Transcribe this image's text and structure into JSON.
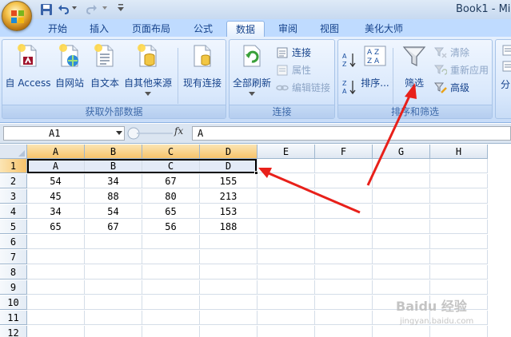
{
  "window": {
    "title": "Book1 - Mi"
  },
  "quick_access": {
    "save_icon": "save-icon",
    "undo_icon": "undo-icon",
    "redo_icon": "redo-icon"
  },
  "tabs": [
    {
      "label": "开始",
      "active": false
    },
    {
      "label": "插入",
      "active": false
    },
    {
      "label": "页面布局",
      "active": false
    },
    {
      "label": "公式",
      "active": false
    },
    {
      "label": "数据",
      "active": true
    },
    {
      "label": "审阅",
      "active": false
    },
    {
      "label": "视图",
      "active": false
    },
    {
      "label": "美化大师",
      "active": false
    }
  ],
  "ribbon": {
    "get_external": {
      "label": "获取外部数据",
      "buttons": [
        "自 Access",
        "自网站",
        "自文本",
        "自其他来源",
        "现有连接"
      ]
    },
    "connections": {
      "label": "连接",
      "refresh_all": "全部刷新",
      "small": [
        "连接",
        "属性",
        "编辑链接"
      ]
    },
    "sort_filter": {
      "label": "排序和筛选",
      "sort": "排序...",
      "filter": "筛选",
      "small": [
        "清除",
        "重新应用",
        "高级"
      ]
    },
    "partial": "分"
  },
  "formula_bar": {
    "name_box": "A1",
    "fx_label": "fx",
    "value": "A"
  },
  "grid": {
    "columns": [
      "A",
      "B",
      "C",
      "D",
      "E",
      "F",
      "G",
      "H"
    ],
    "rows": [
      "1",
      "2",
      "3",
      "4",
      "5",
      "6",
      "7",
      "8",
      "9",
      "10",
      "11",
      "12"
    ],
    "data": [
      [
        "A",
        "B",
        "C",
        "D"
      ],
      [
        "54",
        "34",
        "67",
        "155"
      ],
      [
        "45",
        "88",
        "80",
        "213"
      ],
      [
        "34",
        "54",
        "65",
        "153"
      ],
      [
        "65",
        "67",
        "56",
        "188"
      ]
    ]
  },
  "watermark": {
    "brand": "Baidu 经验",
    "url": "jingyan.baidu.com"
  },
  "colors": {
    "arrow": "#e8201a",
    "selected_header": "#f7c36b",
    "ribbon_text": "#15428b"
  }
}
